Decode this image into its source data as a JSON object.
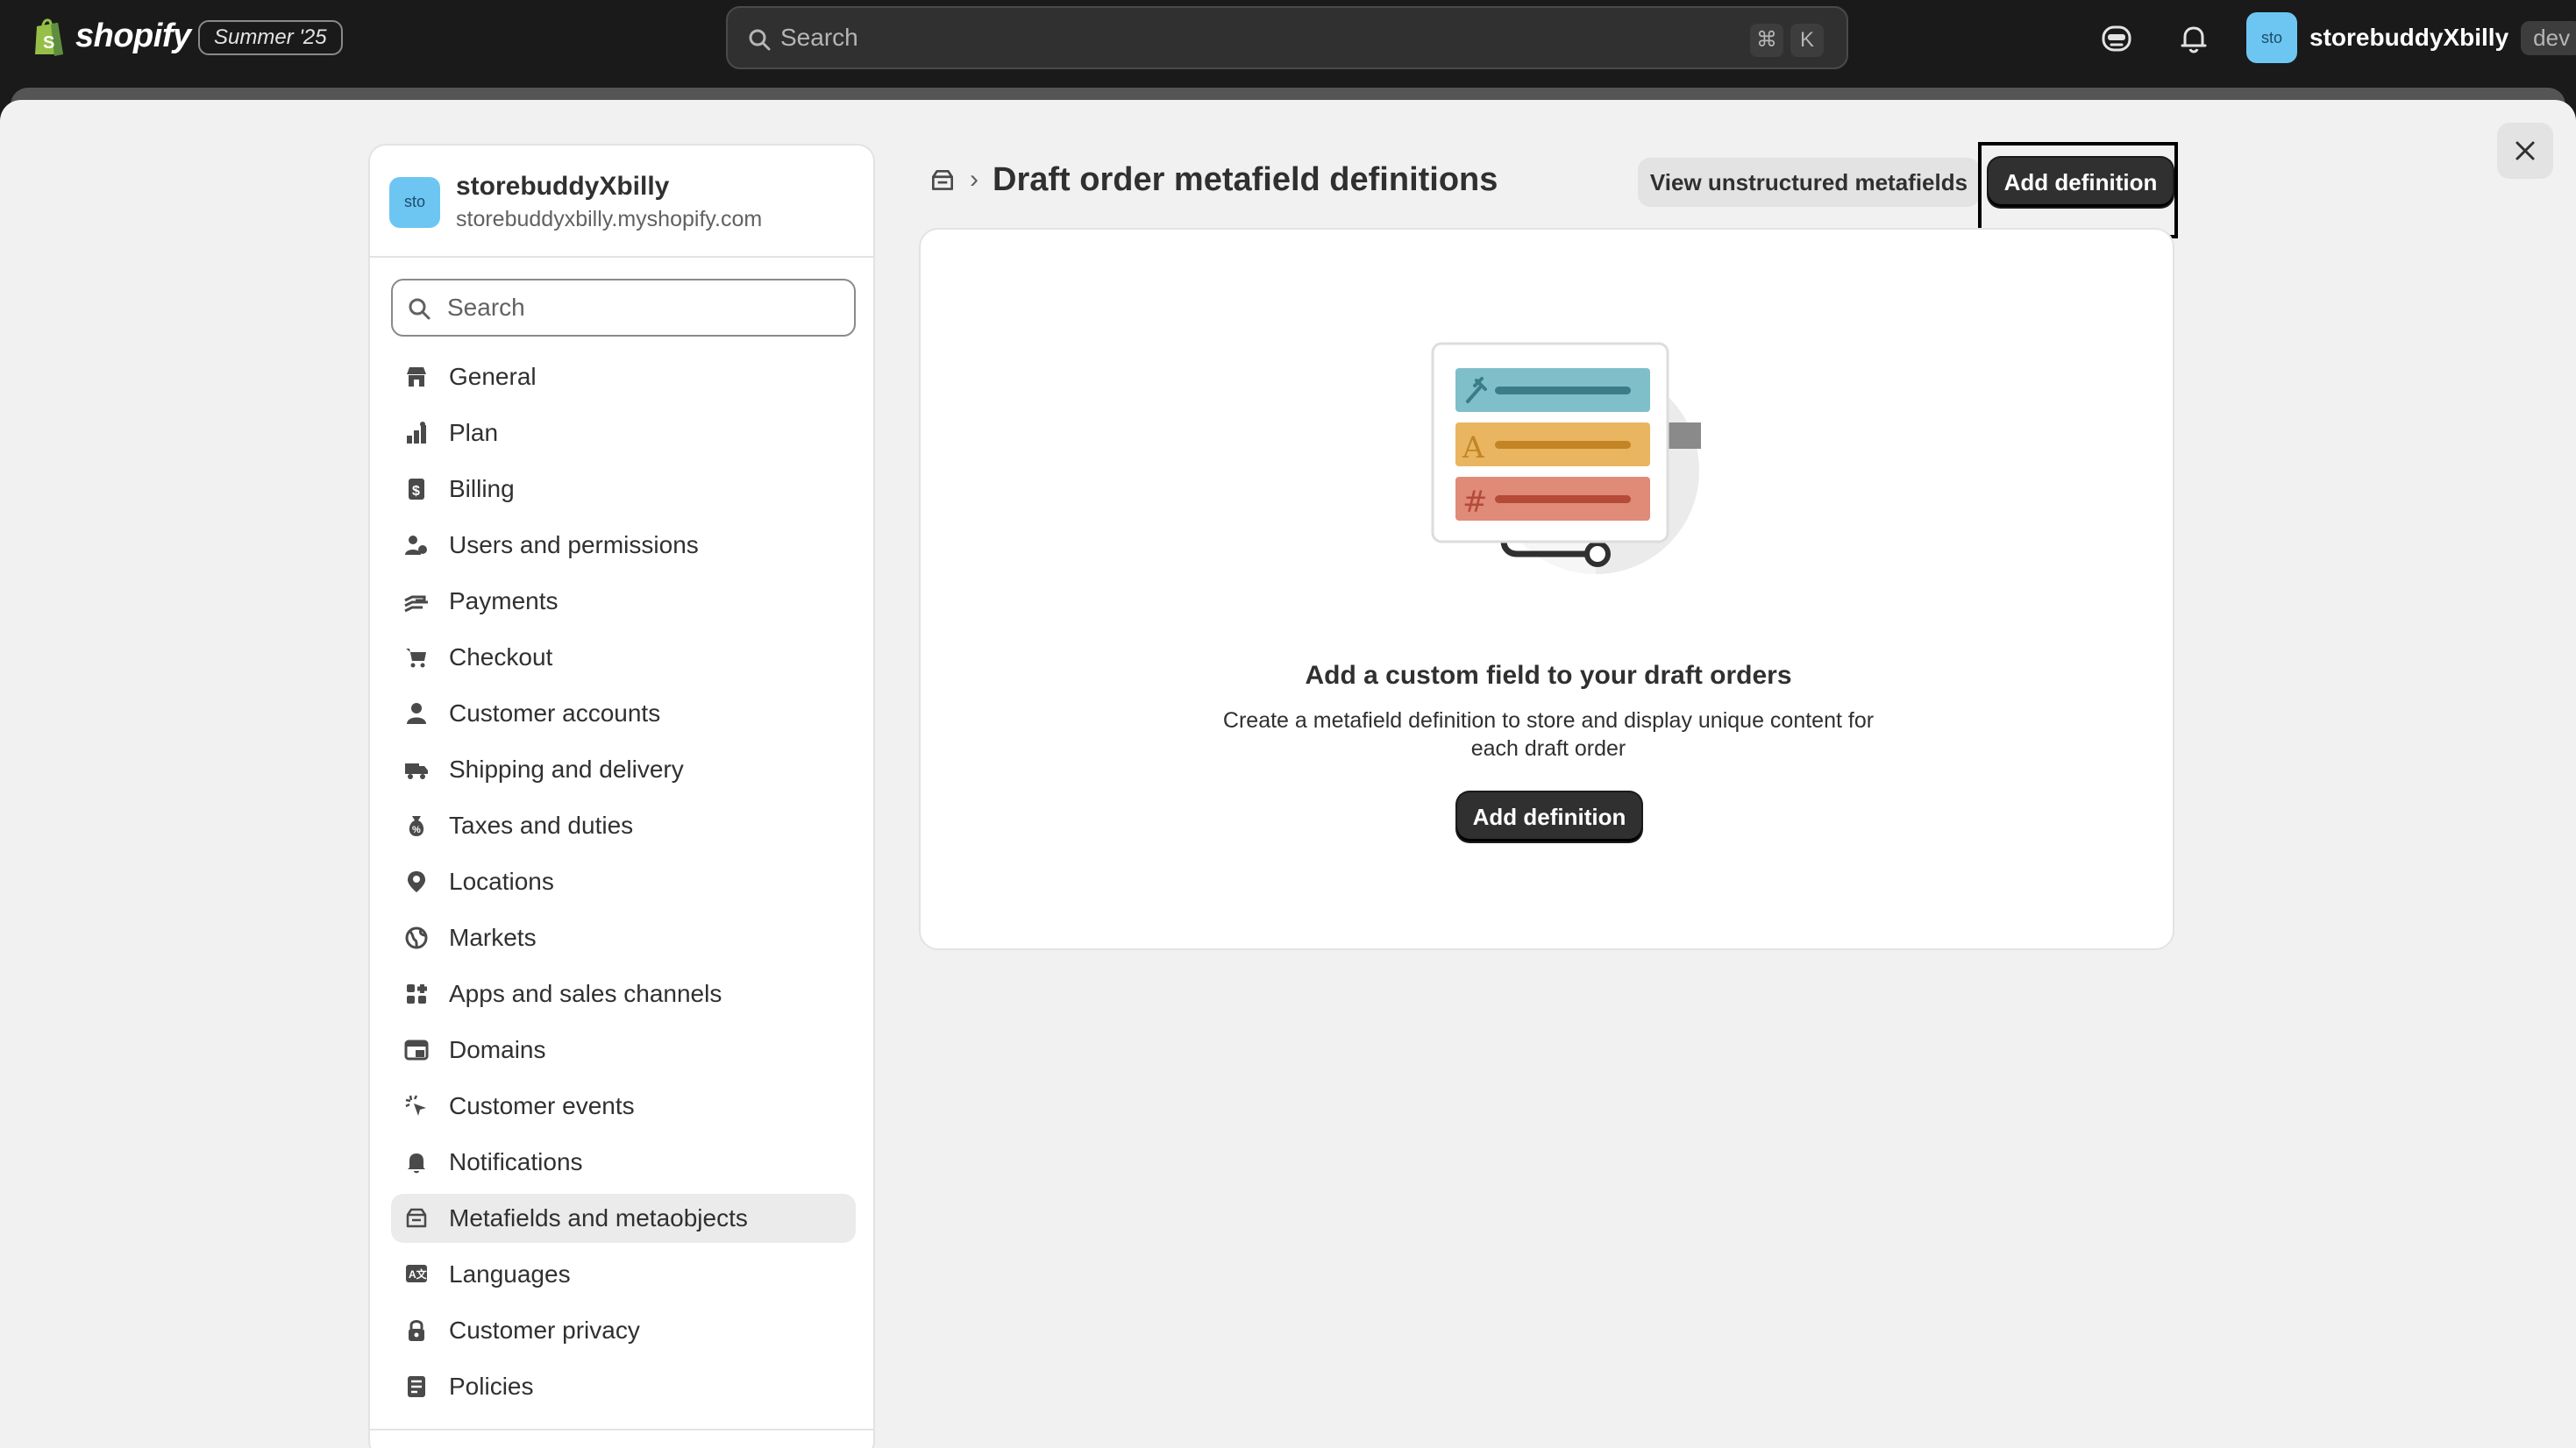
{
  "topbar": {
    "logo_text": "shopify",
    "edition_badge": "Summer '25",
    "search_placeholder": "Search",
    "shortcut_cmd": "⌘",
    "shortcut_key": "K",
    "account_initials": "sto",
    "account_name": "storebuddyXbilly",
    "account_badge": "dev"
  },
  "sidebar": {
    "store_initials": "sto",
    "store_name": "storebuddyXbilly",
    "store_url": "storebuddyxbilly.myshopify.com",
    "search_placeholder": "Search",
    "items": [
      {
        "label": "General",
        "icon": "store-icon"
      },
      {
        "label": "Plan",
        "icon": "plan-icon"
      },
      {
        "label": "Billing",
        "icon": "billing-icon"
      },
      {
        "label": "Users and permissions",
        "icon": "users-icon"
      },
      {
        "label": "Payments",
        "icon": "payments-icon"
      },
      {
        "label": "Checkout",
        "icon": "cart-icon"
      },
      {
        "label": "Customer accounts",
        "icon": "person-icon"
      },
      {
        "label": "Shipping and delivery",
        "icon": "truck-icon"
      },
      {
        "label": "Taxes and duties",
        "icon": "tax-icon"
      },
      {
        "label": "Locations",
        "icon": "location-icon"
      },
      {
        "label": "Markets",
        "icon": "globe-icon"
      },
      {
        "label": "Apps and sales channels",
        "icon": "apps-icon"
      },
      {
        "label": "Domains",
        "icon": "domains-icon"
      },
      {
        "label": "Customer events",
        "icon": "cursor-icon"
      },
      {
        "label": "Notifications",
        "icon": "bell-icon"
      },
      {
        "label": "Metafields and metaobjects",
        "icon": "metafields-icon",
        "active": true
      },
      {
        "label": "Languages",
        "icon": "language-icon"
      },
      {
        "label": "Customer privacy",
        "icon": "lock-icon"
      },
      {
        "label": "Policies",
        "icon": "policies-icon"
      }
    ]
  },
  "main": {
    "title": "Draft order metafield definitions",
    "view_unstructured_label": "View unstructured metafields",
    "add_definition_label": "Add definition",
    "empty_title": "Add a custom field to your draft orders",
    "empty_description": "Create a metafield definition to store and display unique content for each draft order",
    "empty_button_label": "Add definition"
  },
  "colors": {
    "primary_button": "#303030",
    "accent_avatar": "#6dc6f2",
    "illu_teal": "#7fbfc9",
    "illu_yellow": "#e9b560",
    "illu_red": "#e08a78"
  }
}
